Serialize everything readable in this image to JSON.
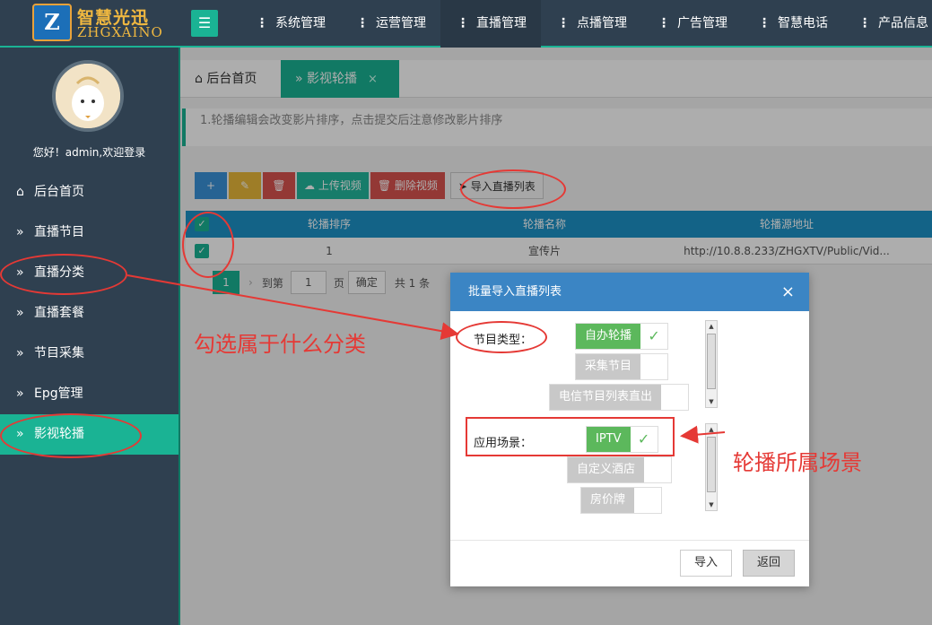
{
  "logo": {
    "mark": "Z",
    "cn": "智慧光迅",
    "en": "ZHGXAINO"
  },
  "menu_toggle": "☰",
  "nav": [
    "系统管理",
    "运营管理",
    "直播管理",
    "点播管理",
    "广告管理",
    "智慧电话",
    "产品信息"
  ],
  "nav_active": "直播管理",
  "sidebar": {
    "welcome": "您好！admin,欢迎登录",
    "items": [
      {
        "label": "后台首页",
        "icon": "home-icon"
      },
      {
        "label": "直播节目",
        "icon": "double-chevron-icon"
      },
      {
        "label": "直播分类",
        "icon": "double-chevron-icon"
      },
      {
        "label": "直播套餐",
        "icon": "double-chevron-icon"
      },
      {
        "label": "节目采集",
        "icon": "double-chevron-icon"
      },
      {
        "label": "Epg管理",
        "icon": "double-chevron-icon"
      },
      {
        "label": "影视轮播",
        "icon": "double-chevron-icon",
        "active": true
      }
    ]
  },
  "tabs": {
    "home": "后台首页",
    "current": "影视轮播",
    "close": "×"
  },
  "tip": "1.轮播编辑会改变影片排序，点击提交后注意修改影片排序",
  "toolbar": {
    "add": "+",
    "edit": "✎",
    "delete": "🗑",
    "upload": "上传视频",
    "remove": "删除视频",
    "import": "导入直播列表"
  },
  "table": {
    "headers": [
      "轮播排序",
      "轮播名称",
      "轮播源地址"
    ],
    "rows": [
      [
        "1",
        "宣传片",
        "http://10.8.8.233/ZHGXTV/Public/Vid..."
      ]
    ]
  },
  "pager": {
    "current": "1",
    "goto": "到第",
    "page_value": "1",
    "page_unit": "页",
    "confirm": "确定",
    "total": "共 1 条"
  },
  "modal": {
    "title": "批量导入直播列表",
    "close": "×",
    "type_label": "节目类型：",
    "type_options": [
      {
        "label": "自办轮播",
        "checked": true
      },
      {
        "label": "采集节目",
        "checked": false
      },
      {
        "label": "电信节目列表直出",
        "checked": false
      }
    ],
    "scene_label": "应用场景：",
    "scene_options": [
      {
        "label": "IPTV",
        "checked": true
      },
      {
        "label": "自定义酒店",
        "checked": false
      },
      {
        "label": "房价牌",
        "checked": false
      }
    ],
    "import_btn": "导入",
    "back_btn": "返回"
  },
  "annotations": {
    "left": "勾选属于什么分类",
    "right": "轮播所属场景",
    "color": "#e53935"
  }
}
